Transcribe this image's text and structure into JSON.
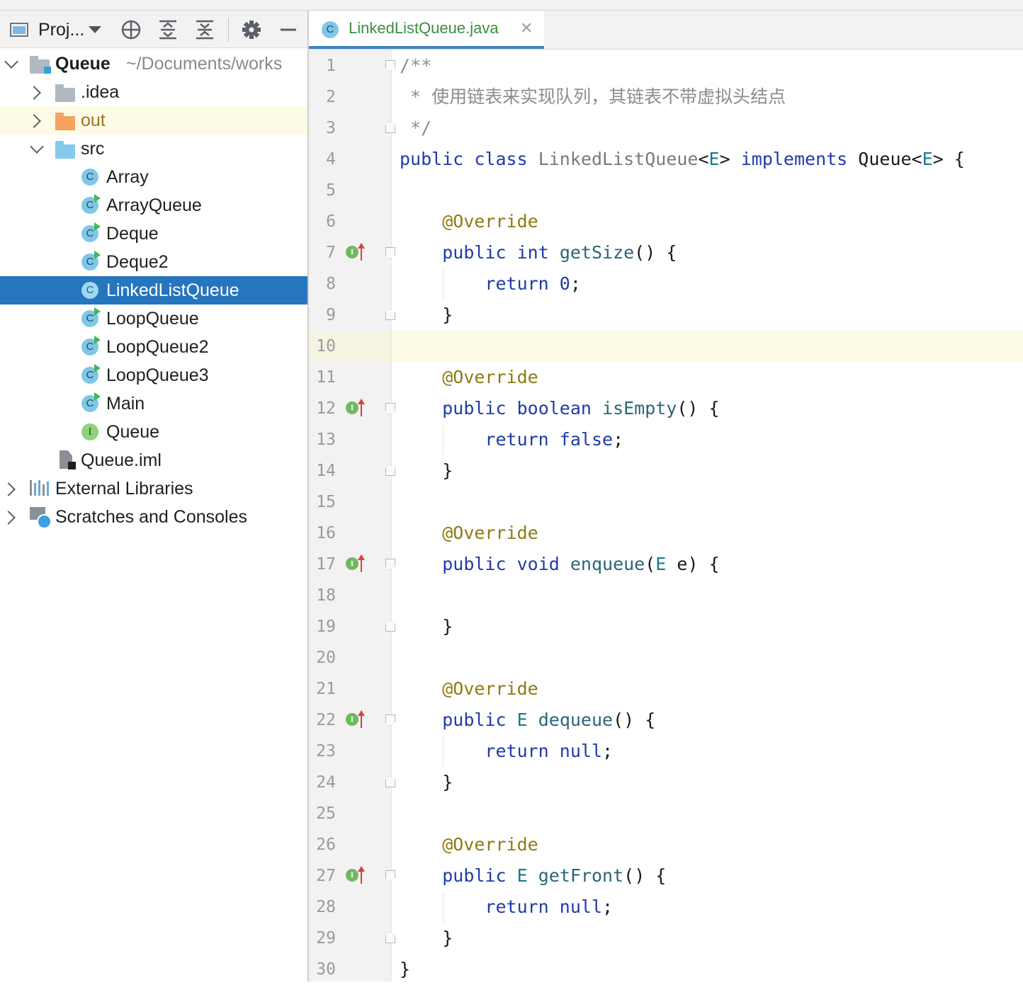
{
  "project_panel": {
    "title": "Proj...",
    "tree": [
      {
        "label": "Queue",
        "path": "~/Documents/works",
        "level": 0,
        "expanded": true,
        "icon": "module-folder-icon"
      },
      {
        "label": ".idea",
        "level": 1,
        "expanded": false,
        "icon": "folder-icon"
      },
      {
        "label": "out",
        "level": 1,
        "expanded": false,
        "icon": "excluded-folder-icon"
      },
      {
        "label": "src",
        "level": 1,
        "expanded": true,
        "icon": "source-folder-icon"
      },
      {
        "label": "Array",
        "level": 2,
        "icon": "class-icon"
      },
      {
        "label": "ArrayQueue",
        "level": 2,
        "icon": "runnable-class-icon"
      },
      {
        "label": "Deque",
        "level": 2,
        "icon": "runnable-class-icon"
      },
      {
        "label": "Deque2",
        "level": 2,
        "icon": "runnable-class-icon"
      },
      {
        "label": "LinkedListQueue",
        "level": 2,
        "icon": "class-icon",
        "selected": true
      },
      {
        "label": "LoopQueue",
        "level": 2,
        "icon": "runnable-class-icon"
      },
      {
        "label": "LoopQueue2",
        "level": 2,
        "icon": "runnable-class-icon"
      },
      {
        "label": "LoopQueue3",
        "level": 2,
        "icon": "runnable-class-icon"
      },
      {
        "label": "Main",
        "level": 2,
        "icon": "runnable-class-icon"
      },
      {
        "label": "Queue",
        "level": 2,
        "icon": "interface-icon"
      },
      {
        "label": "Queue.iml",
        "level": 1,
        "icon": "iml-file-icon"
      },
      {
        "label": "External Libraries",
        "level": 0,
        "expanded": false,
        "icon": "libraries-icon"
      },
      {
        "label": "Scratches and Consoles",
        "level": 0,
        "expanded": false,
        "icon": "scratches-icon"
      }
    ]
  },
  "editor": {
    "tab": {
      "title": "LinkedListQueue.java",
      "icon_letter": "C"
    },
    "caret_line": 10,
    "lines": [
      {
        "n": "1",
        "text": "/**"
      },
      {
        "n": "2",
        "text": " * 使用链表来实现队列，其链表不带虚拟头结点"
      },
      {
        "n": "3",
        "text": " */"
      },
      {
        "n": "4",
        "text": "public class LinkedListQueue<E> implements Queue<E> {"
      },
      {
        "n": "5",
        "text": ""
      },
      {
        "n": "6",
        "text": "    @Override"
      },
      {
        "n": "7",
        "text": "    public int getSize() {"
      },
      {
        "n": "8",
        "text": "        return 0;"
      },
      {
        "n": "9",
        "text": "    }"
      },
      {
        "n": "10",
        "text": ""
      },
      {
        "n": "11",
        "text": "    @Override"
      },
      {
        "n": "12",
        "text": "    public boolean isEmpty() {"
      },
      {
        "n": "13",
        "text": "        return false;"
      },
      {
        "n": "14",
        "text": "    }"
      },
      {
        "n": "15",
        "text": ""
      },
      {
        "n": "16",
        "text": "    @Override"
      },
      {
        "n": "17",
        "text": "    public void enqueue(E e) {"
      },
      {
        "n": "18",
        "text": ""
      },
      {
        "n": "19",
        "text": "    }"
      },
      {
        "n": "20",
        "text": ""
      },
      {
        "n": "21",
        "text": "    @Override"
      },
      {
        "n": "22",
        "text": "    public E dequeue() {"
      },
      {
        "n": "23",
        "text": "        return null;"
      },
      {
        "n": "24",
        "text": "    }"
      },
      {
        "n": "25",
        "text": ""
      },
      {
        "n": "26",
        "text": "    @Override"
      },
      {
        "n": "27",
        "text": "    public E getFront() {"
      },
      {
        "n": "28",
        "text": "        return null;"
      },
      {
        "n": "29",
        "text": "    }"
      },
      {
        "n": "30",
        "text": "}"
      }
    ]
  },
  "colors": {
    "selection": "#2675bf",
    "keyword": "#1f3ba8",
    "annotation": "#8f7a12",
    "comment": "#8c8c8c",
    "tab_title": "#3c8e3c"
  }
}
